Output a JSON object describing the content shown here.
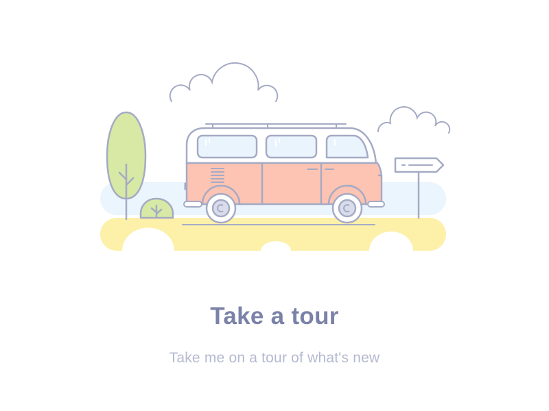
{
  "onboarding": {
    "title": "Take a tour",
    "subtitle": "Take me on a tour of what's new"
  },
  "illustration": {
    "subject": "van-on-road-illustration",
    "icons": [
      "cloud-icon",
      "tree-icon",
      "bush-icon",
      "van-icon",
      "signpost-icon"
    ]
  },
  "colors": {
    "outline": "#a5aac4",
    "van_body": "#fdc4b3",
    "van_top": "#ffffff",
    "window": "#eaf4fd",
    "tree": "#d7e9a5",
    "ground": "#fdf0a8",
    "sky_band": "#eaf5fd",
    "title": "#7b82a8",
    "subtitle": "#b4b9cf"
  }
}
